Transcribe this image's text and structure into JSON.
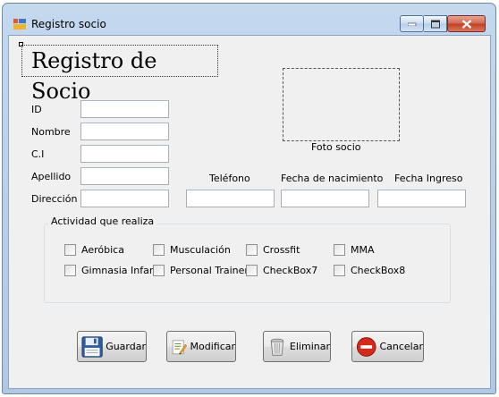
{
  "window": {
    "title": "Registro socio"
  },
  "form": {
    "heading": "Registro de Socio",
    "fields": {
      "id_label": "ID",
      "nombre_label": "Nombre",
      "ci_label": "C.I",
      "apellido_label": "Apellido",
      "direccion_label": "Dirección",
      "telefono_label": "Teléfono",
      "fecha_nacimiento_label": "Fecha de nacimiento",
      "fecha_ingreso_label": "Fecha Ingreso",
      "foto_label": "Foto socio"
    },
    "activities": {
      "legend": "Actividad que realiza",
      "items": [
        "Aeróbica",
        "Musculación",
        "Crossfit",
        "MMA",
        "Gimnasia Infantil",
        "Personal Trainer",
        "CheckBox7",
        "CheckBox8"
      ]
    },
    "buttons": {
      "guardar": "Guardar",
      "modificar": "Modificar",
      "eliminar": "Eliminar",
      "cancelar": "Cancelar"
    }
  }
}
